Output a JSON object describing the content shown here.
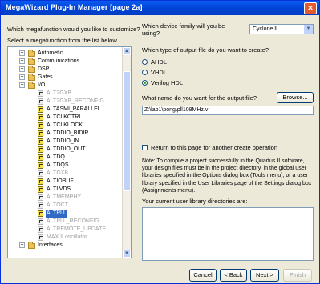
{
  "window": {
    "title": "MegaWizard Plug-In Manager [page 2a]",
    "close": "✕"
  },
  "left": {
    "question": "Which megafunction would you like to customize?",
    "instruction": "Select a megafunction from the list below"
  },
  "tree": [
    {
      "label": "Arithmetic",
      "kind": "folder",
      "expanded": false,
      "indent": 0
    },
    {
      "label": "Communications",
      "kind": "folder",
      "expanded": false,
      "indent": 0
    },
    {
      "label": "DSP",
      "kind": "folder",
      "expanded": false,
      "indent": 0
    },
    {
      "label": "Gates",
      "kind": "folder",
      "expanded": false,
      "indent": 0
    },
    {
      "label": "I/O",
      "kind": "folder",
      "expanded": true,
      "indent": 0
    },
    {
      "label": "ALT2GXB",
      "kind": "item",
      "disabled": true
    },
    {
      "label": "ALT2GXB_RECONFIG",
      "kind": "item",
      "disabled": true
    },
    {
      "label": "ALTASMI_PARALLEL",
      "kind": "item",
      "disabled": false
    },
    {
      "label": "ALTCLKCTRL",
      "kind": "item",
      "disabled": false
    },
    {
      "label": "ALTCLKLOCK",
      "kind": "item",
      "disabled": false
    },
    {
      "label": "ALTDDIO_BIDIR",
      "kind": "item",
      "disabled": false
    },
    {
      "label": "ALTDDIO_IN",
      "kind": "item",
      "disabled": false
    },
    {
      "label": "ALTDDIO_OUT",
      "kind": "item",
      "disabled": false
    },
    {
      "label": "ALTDQ",
      "kind": "item",
      "disabled": false
    },
    {
      "label": "ALTDQS",
      "kind": "item",
      "disabled": false
    },
    {
      "label": "ALTGXB",
      "kind": "item",
      "disabled": true
    },
    {
      "label": "ALTIOBUF",
      "kind": "item",
      "disabled": false
    },
    {
      "label": "ALTLVDS",
      "kind": "item",
      "disabled": false
    },
    {
      "label": "ALTMEMPHY",
      "kind": "item",
      "disabled": true
    },
    {
      "label": "ALTOCT",
      "kind": "item",
      "disabled": true
    },
    {
      "label": "ALTPLL",
      "kind": "item",
      "disabled": false,
      "selected": true
    },
    {
      "label": "ALTPLL_RECONFIG",
      "kind": "item",
      "disabled": true
    },
    {
      "label": "ALTREMOTE_UPDATE",
      "kind": "item",
      "disabled": true
    },
    {
      "label": "MAX II oscillator",
      "kind": "item",
      "disabled": true
    },
    {
      "label": "Interfaces",
      "kind": "folder",
      "expanded": false,
      "indent": 0
    }
  ],
  "right": {
    "device_question": "Which device family will you be using?",
    "device_family": "Cyclone II",
    "output_type_question": "Which type of output file do you want to create?",
    "output_types": [
      {
        "label": "AHDL",
        "selected": false
      },
      {
        "label": "VHDL",
        "selected": false
      },
      {
        "label": "Verilog HDL",
        "selected": true
      }
    ],
    "filename_question": "What name do you want for the output file?",
    "browse": "Browse...",
    "filename": "Z:\\lab1\\pong\\pll108MHz.v",
    "return_checkbox": "Return to this page for another create operation",
    "note": "Note: To compile a project successfully in the Quartus II software, your design files must be in the project directory, in the global user libraries specified in the Options dialog box (Tools menu), or a user library specified in the User Libraries page of the Settings dialog box (Assignments menu).",
    "libdirs_label": "Your current user library directories are:"
  },
  "footer": {
    "cancel": "Cancel",
    "back": "< Back",
    "next": "Next >",
    "finish": "Finish"
  }
}
